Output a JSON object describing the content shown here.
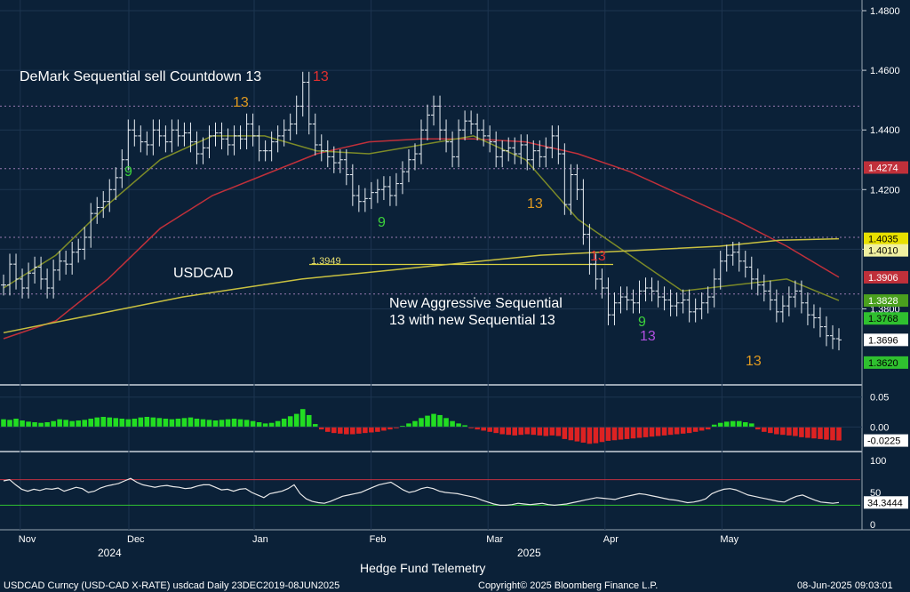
{
  "footer": {
    "left": "USDCAD Curncy (USD-CAD X-RATE) usdcad  Daily 23DEC2019-08JUN2025",
    "center": "Copyright© 2025 Bloomberg Finance L.P.",
    "right": "08-Jun-2025 09:03:01",
    "credit": "Hedge Fund Telemetry"
  },
  "annotations": {
    "sell_countdown": "DeMark Sequential sell Countdown 13",
    "symbol": "USDCAD",
    "aggressive_line1": "New Aggressive Sequential",
    "aggressive_line2": "13 with new Sequential 13",
    "level_label": "1.3949"
  },
  "x_axis": {
    "months": [
      "Nov",
      "Dec",
      "Jan",
      "Feb",
      "Mar",
      "Apr",
      "May"
    ],
    "years": [
      "2024",
      "2025"
    ]
  },
  "colors": {
    "background": "#0b2138",
    "candles": "#e8eef4",
    "ma_red": "#c0303a",
    "ma_olive": "#7c8a28",
    "ma_yellow": "#c8c040",
    "setup_green": "#3cd23c",
    "countdown_red": "#e03030",
    "countdown_orange": "#e09a20",
    "macd_pos": "#22dd22",
    "macd_neg": "#dd2222"
  },
  "chart_data": [
    {
      "type": "candlestick",
      "title": "USDCAD",
      "ylim": [
        1.356,
        1.48
      ],
      "y_ticks": [
        "1.4800",
        "1.4600",
        "1.4400",
        "1.4200",
        "1.4000",
        "1.3800"
      ],
      "price_labels": [
        {
          "value": "1.4274",
          "color": "#c0303a",
          "text_color": "#ffffff"
        },
        {
          "value": "1.4035",
          "color": "#e8e000",
          "text_color": "#000000"
        },
        {
          "value": "1.4010",
          "color": "#f0f0a0",
          "text_color": "#000000"
        },
        {
          "value": "1.3906",
          "color": "#c0303a",
          "text_color": "#ffffff"
        },
        {
          "value": "1.3828",
          "color": "#4aa01e",
          "text_color": "#ffffff"
        },
        {
          "value": "1.3768",
          "color": "#2fc02f",
          "text_color": "#000000"
        },
        {
          "value": "1.3696",
          "color": "#ffffff",
          "text_color": "#000000"
        },
        {
          "value": "1.3620",
          "color": "#2fc02f",
          "text_color": "#000000"
        }
      ],
      "series": [
        {
          "name": "close",
          "values": [
            1.388,
            1.395,
            1.39,
            1.387,
            1.392,
            1.394,
            1.39,
            1.387,
            1.393,
            1.396,
            1.395,
            1.399,
            1.4,
            1.404,
            1.412,
            1.414,
            1.416,
            1.42,
            1.424,
            1.43,
            1.44,
            1.438,
            1.436,
            1.435,
            1.44,
            1.438,
            1.436,
            1.44,
            1.438,
            1.439,
            1.436,
            1.432,
            1.434,
            1.438,
            1.439,
            1.437,
            1.435,
            1.438,
            1.437,
            1.442,
            1.438,
            1.433,
            1.433,
            1.436,
            1.438,
            1.44,
            1.442,
            1.448,
            1.456,
            1.442,
            1.435,
            1.433,
            1.431,
            1.429,
            1.43,
            1.425,
            1.418,
            1.416,
            1.417,
            1.419,
            1.42,
            1.421,
            1.418,
            1.422,
            1.426,
            1.43,
            1.432,
            1.44,
            1.445,
            1.448,
            1.44,
            1.436,
            1.431,
            1.44,
            1.443,
            1.442,
            1.44,
            1.438,
            1.436,
            1.431,
            1.433,
            1.434,
            1.432,
            1.435,
            1.43,
            1.433,
            1.431,
            1.434,
            1.438,
            1.432,
            1.415,
            1.425,
            1.42,
            1.405,
            1.395,
            1.39,
            1.387,
            1.378,
            1.382,
            1.384,
            1.383,
            1.382,
            1.386,
            1.387,
            1.386,
            1.384,
            1.383,
            1.381,
            1.382,
            1.383,
            1.379,
            1.38,
            1.382,
            1.384,
            1.39,
            1.396,
            1.398,
            1.399,
            1.396,
            1.394,
            1.39,
            1.388,
            1.386,
            1.383,
            1.379,
            1.381,
            1.384,
            1.386,
            1.382,
            1.378,
            1.377,
            1.374,
            1.371,
            1.37,
            1.3696
          ]
        },
        {
          "name": "ma_red",
          "values": [
            1.37,
            1.376,
            1.39,
            1.407,
            1.418,
            1.425,
            1.432,
            1.436,
            1.437,
            1.437,
            1.436,
            1.432,
            1.426,
            1.418,
            1.41,
            1.401,
            1.3906
          ]
        },
        {
          "name": "ma_olive",
          "values": [
            1.387,
            1.398,
            1.415,
            1.43,
            1.438,
            1.438,
            1.433,
            1.432,
            1.435,
            1.438,
            1.43,
            1.41,
            1.398,
            1.386,
            1.388,
            1.39,
            1.3828
          ]
        },
        {
          "name": "ma_yellow",
          "values": [
            1.372,
            1.376,
            1.38,
            1.384,
            1.387,
            1.39,
            1.392,
            1.394,
            1.396,
            1.398,
            1.399,
            1.4,
            1.401,
            1.403,
            1.4035
          ]
        }
      ],
      "dotted_levels": [
        1.448,
        1.427,
        1.404,
        1.385
      ],
      "solid_level": 1.3949
    },
    {
      "type": "bar",
      "name": "MACD histogram",
      "ylim": [
        -0.035,
        0.06
      ],
      "y_ticks": [
        "0.05",
        "0.00"
      ],
      "last_value_label": "-0.0225",
      "values": [
        0.013,
        0.012,
        0.014,
        0.011,
        0.009,
        0.008,
        0.007,
        0.008,
        0.01,
        0.013,
        0.012,
        0.01,
        0.011,
        0.012,
        0.014,
        0.016,
        0.017,
        0.016,
        0.015,
        0.014,
        0.013,
        0.014,
        0.016,
        0.017,
        0.016,
        0.015,
        0.014,
        0.013,
        0.014,
        0.015,
        0.016,
        0.014,
        0.013,
        0.012,
        0.011,
        0.012,
        0.013,
        0.014,
        0.013,
        0.012,
        0.01,
        0.008,
        0.006,
        0.007,
        0.01,
        0.014,
        0.018,
        0.022,
        0.03,
        0.02,
        0.005,
        -0.004,
        -0.008,
        -0.01,
        -0.011,
        -0.012,
        -0.012,
        -0.011,
        -0.01,
        -0.009,
        -0.008,
        -0.006,
        -0.004,
        -0.002,
        0.002,
        0.006,
        0.01,
        0.015,
        0.019,
        0.022,
        0.02,
        0.015,
        0.01,
        0.006,
        0.003,
        -0.002,
        -0.004,
        -0.006,
        -0.008,
        -0.01,
        -0.012,
        -0.013,
        -0.014,
        -0.013,
        -0.012,
        -0.013,
        -0.014,
        -0.015,
        -0.014,
        -0.015,
        -0.02,
        -0.022,
        -0.024,
        -0.026,
        -0.028,
        -0.027,
        -0.025,
        -0.023,
        -0.022,
        -0.021,
        -0.02,
        -0.019,
        -0.018,
        -0.017,
        -0.016,
        -0.015,
        -0.014,
        -0.013,
        -0.012,
        -0.011,
        -0.01,
        -0.008,
        -0.006,
        -0.004,
        0.004,
        0.007,
        0.009,
        0.01,
        0.01,
        0.008,
        0.006,
        -0.004,
        -0.008,
        -0.01,
        -0.012,
        -0.013,
        -0.014,
        -0.015,
        -0.017,
        -0.018,
        -0.019,
        -0.02,
        -0.021,
        -0.022,
        -0.0225
      ]
    },
    {
      "type": "line",
      "name": "RSI",
      "ylim": [
        0,
        100
      ],
      "y_ticks": [
        "100",
        "50",
        "0"
      ],
      "reference_levels": [
        70,
        30
      ],
      "last_value_label": "34.3444",
      "values": [
        68,
        70,
        62,
        55,
        52,
        55,
        53,
        56,
        55,
        57,
        52,
        55,
        58,
        56,
        50,
        52,
        57,
        60,
        62,
        64,
        68,
        72,
        66,
        62,
        60,
        58,
        60,
        61,
        59,
        58,
        56,
        57,
        60,
        62,
        62,
        58,
        54,
        55,
        52,
        55,
        56,
        50,
        46,
        42,
        48,
        50,
        52,
        56,
        62,
        48,
        40,
        36,
        34,
        33,
        36,
        40,
        44,
        46,
        48,
        50,
        54,
        58,
        62,
        64,
        66,
        60,
        54,
        50,
        52,
        56,
        58,
        56,
        52,
        50,
        49,
        48,
        46,
        44,
        42,
        38,
        35,
        32,
        30,
        30,
        31,
        33,
        32,
        31,
        32,
        33,
        31,
        30,
        31,
        32,
        34,
        36,
        38,
        40,
        42,
        41,
        40,
        39,
        42,
        44,
        46,
        48,
        47,
        45,
        43,
        41,
        39,
        38,
        36,
        34,
        35,
        37,
        40,
        48,
        52,
        55,
        56,
        54,
        50,
        46,
        44,
        42,
        40,
        38,
        36,
        35,
        40,
        44,
        46,
        42,
        38,
        35,
        34,
        33,
        34.3444
      ]
    }
  ]
}
